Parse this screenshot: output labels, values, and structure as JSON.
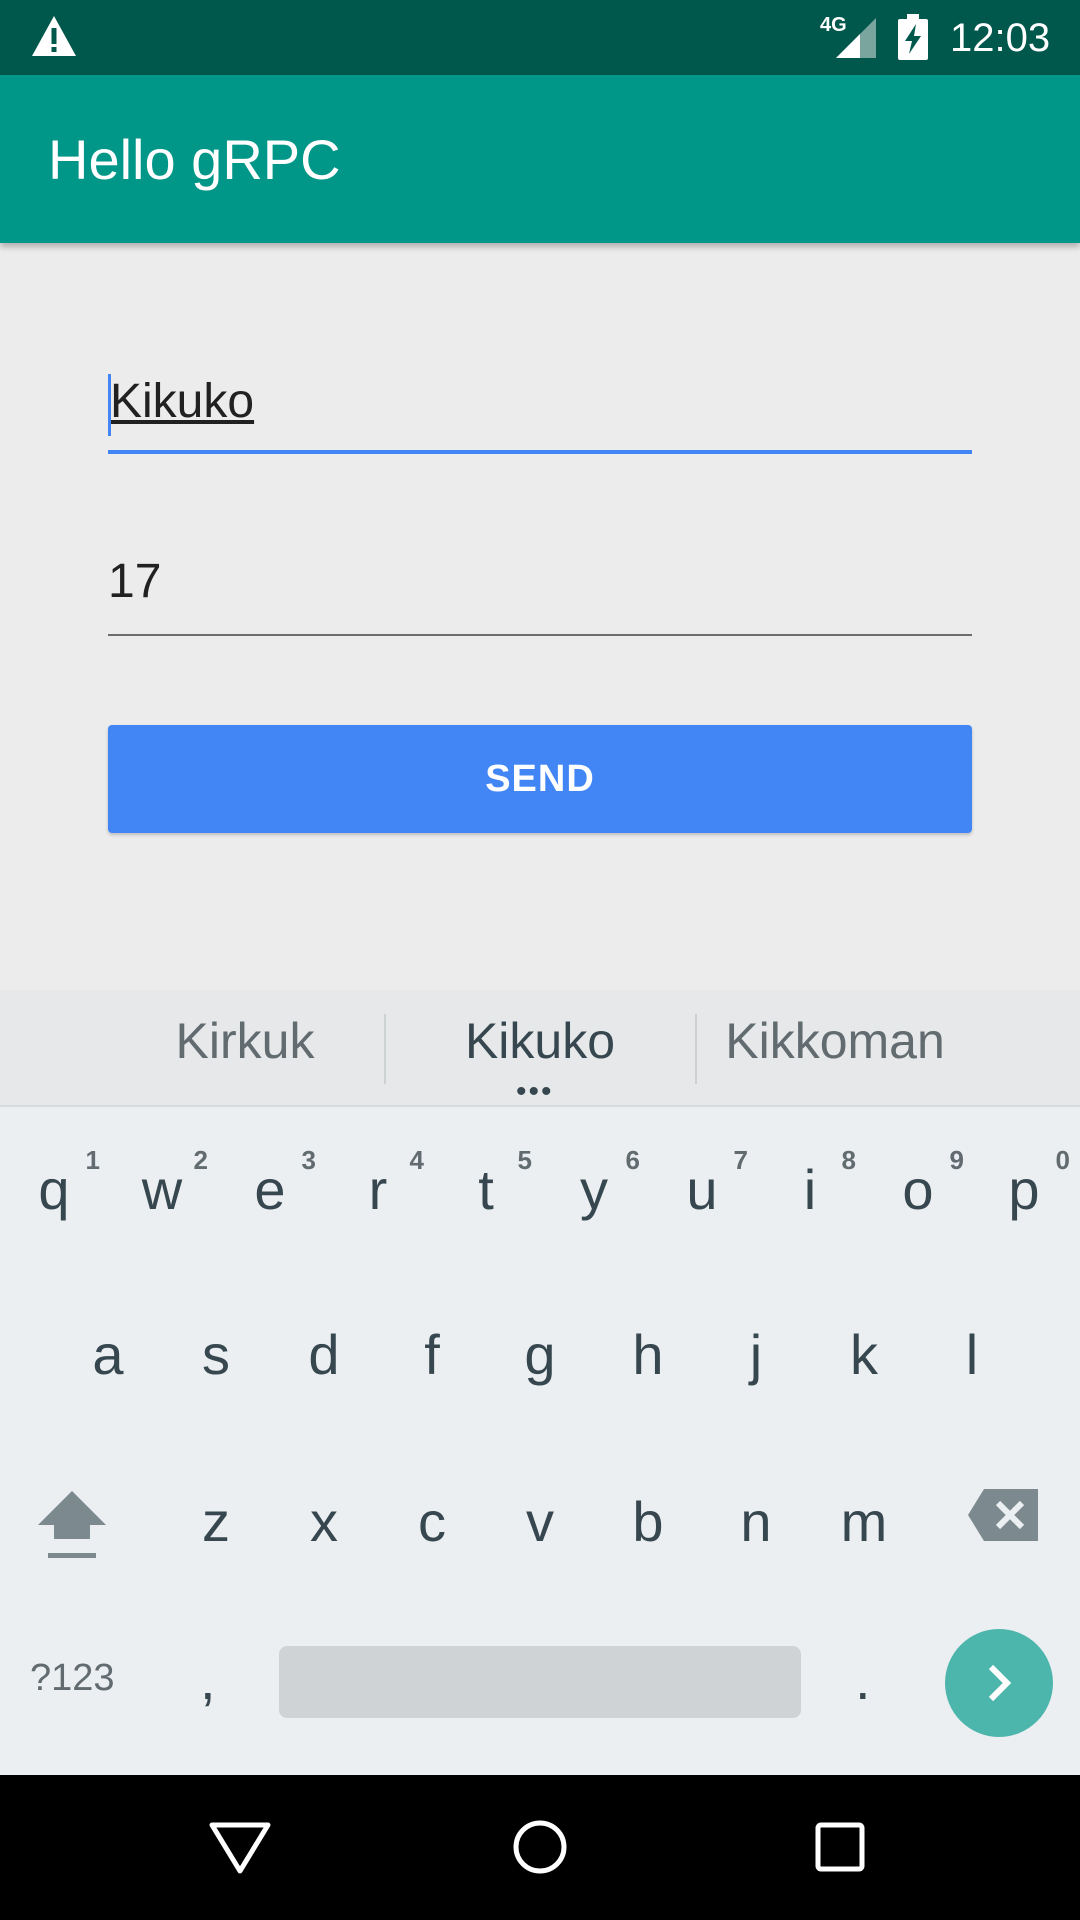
{
  "status_bar": {
    "network": "4G",
    "time": "12:03",
    "icons": [
      "warning-icon",
      "signal-icon",
      "battery-charging-icon"
    ]
  },
  "app_bar": {
    "title": "Hello gRPC"
  },
  "form": {
    "name_value": "Kikuko",
    "age_value": "17",
    "send_label": "SEND"
  },
  "suggestions": [
    "Kirkuk",
    "Kikuko",
    "Kikkoman"
  ],
  "keyboard": {
    "row1": [
      {
        "key": "q",
        "hint": "1"
      },
      {
        "key": "w",
        "hint": "2"
      },
      {
        "key": "e",
        "hint": "3"
      },
      {
        "key": "r",
        "hint": "4"
      },
      {
        "key": "t",
        "hint": "5"
      },
      {
        "key": "y",
        "hint": "6"
      },
      {
        "key": "u",
        "hint": "7"
      },
      {
        "key": "i",
        "hint": "8"
      },
      {
        "key": "o",
        "hint": "9"
      },
      {
        "key": "p",
        "hint": "0"
      }
    ],
    "row2": [
      "a",
      "s",
      "d",
      "f",
      "g",
      "h",
      "j",
      "k",
      "l"
    ],
    "row3": [
      "z",
      "x",
      "c",
      "v",
      "b",
      "n",
      "m"
    ],
    "symbols_label": "?123",
    "comma": ",",
    "period": ".",
    "icons": [
      "shift-icon",
      "backspace-icon",
      "enter-arrow-icon"
    ]
  },
  "nav_bar": {
    "icons": [
      "back-icon",
      "home-icon",
      "recents-icon"
    ]
  },
  "colors": {
    "status_bar": "#00574b",
    "app_bar": "#009688",
    "accent": "#4285f4",
    "enter_key": "#4db6ac"
  }
}
